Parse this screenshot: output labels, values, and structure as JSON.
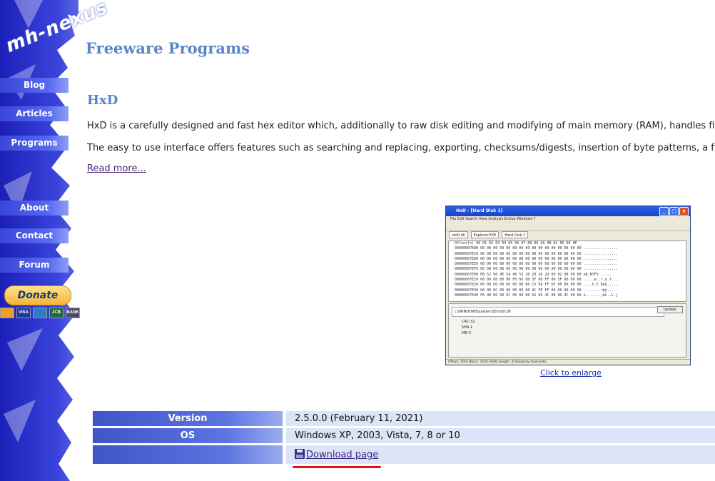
{
  "sidebar": {
    "logo": "mh-nexus",
    "nav": [
      "Blog",
      "Articles",
      "Programs",
      "About",
      "Contact",
      "Forum"
    ],
    "donate": "Donate",
    "cards": [
      "VISA",
      "JCB",
      "BANK"
    ]
  },
  "main": {
    "site_title": "Freeware Programs",
    "program_title": "HxD",
    "para1": "HxD is a carefully designed and fast hex editor which, additionally to raw disk editing and modifying of main memory (RAM), handles files of",
    "para2": "The easy to use interface offers features such as searching and replacing, exporting, checksums/digests, insertion of byte patterns, a file sh",
    "read_more": "Read more...",
    "enlarge": "Click to enlarge"
  },
  "thumbnail": {
    "title": "HxD - [Hard Disk 1]",
    "menu": "File  Edit  Search  View  Analysis  Extras  Windows  ?",
    "tabs": [
      "ntdll.dll",
      "Explorer.EXE",
      "Hard Disk 1"
    ],
    "header": "Offset(h)  00 01 02 03 04 05 06 07 08 09 0A 0B 0C 0D 0E 0F",
    "rows": [
      "00000007E80  00 00 00 00 00 00 00 00 00 00 00 00 00 00 00 00  ................",
      "00000007EC0  00 00 00 00 00 00 00 00 00 00 00 00 00 00 00 00  ................",
      "00000007ED0  00 00 00 00 00 00 00 00 00 00 00 00 00 00 00 00  ................",
      "00000007EE0  00 00 00 00 00 00 00 00 00 00 00 00 00 00 00 00  ................",
      "00000007EF0  00 00 00 00 00 00 00 00 00 00 00 00 00 00 00 00  ................",
      "00000007E00  EB 52 90 4E 54 46 53 20 20 20 20 00 02 08 00 00  eR.NTFS    .....",
      "00000007E10  00 00 00 00 00 F8 00 00 3F 00 FF 00 3F 00 00 00  .....ø..?.y.?...",
      "00000007E20  00 00 00 00 80 00 80 00 C5 EA FF OF 00 00 00 00  ....€.€.Åêÿ.....",
      "00000007E30  00 00 0C 00 00 00 00 00 AC FE FF 00 00 00 00 00  ........¬þÿ.....",
      "00000007E40  F6 00 00 00 01 00 00 00 A1 89 4C 08 9D 4C 08 6A  ö.......¡‰L..L.j"
    ],
    "checksum_path": "c:\\WINDOWS\\system32\\ntdll.dll",
    "update": "Update",
    "algos": [
      "CRC-32",
      "SHA-1",
      "MD-5"
    ],
    "status": "Offset: 7E03      Block: 7E03-7E06      Length: 4      Readonly      Overwrite"
  },
  "info": {
    "version_label": "Version",
    "version_value": "2.5.0.0 (February 11, 2021)",
    "os_label": "OS",
    "os_value": "Windows XP, 2003, Vista, 7, 8 or 10",
    "download": "Download page"
  }
}
